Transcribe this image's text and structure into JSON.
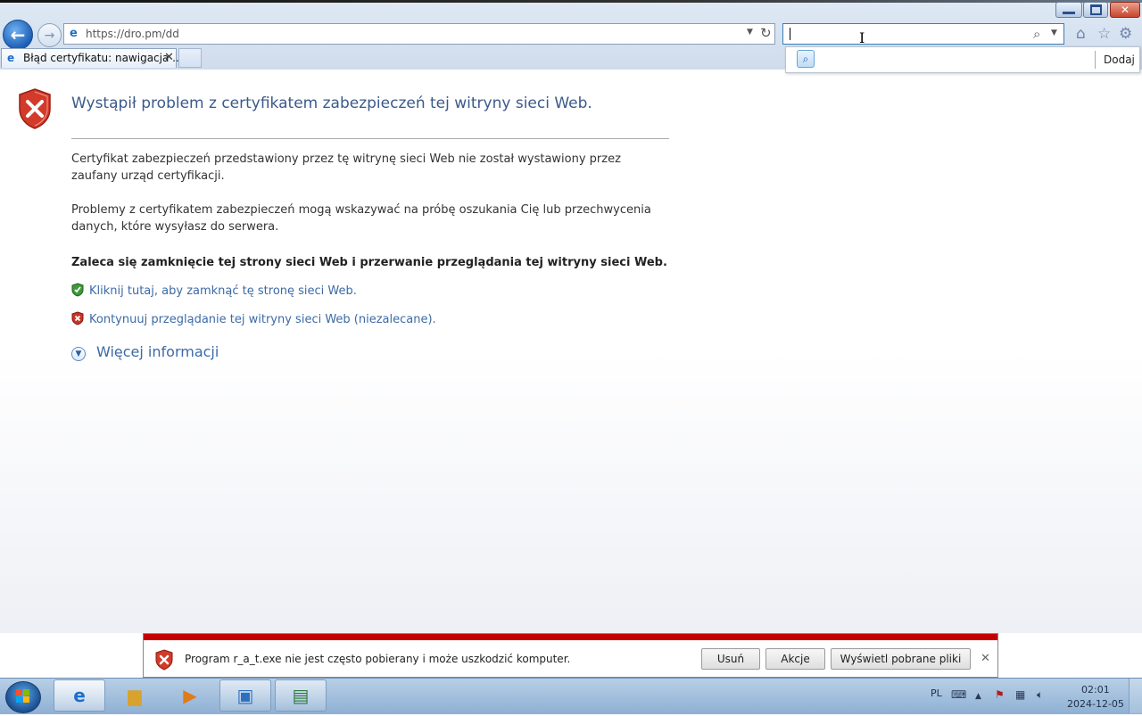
{
  "browser": {
    "url": "https://dro.pm/dd",
    "tab_title": "Błąd certyfikatu: nawigacja ...",
    "search_value": "",
    "suggest_add_label": "Dodaj"
  },
  "page": {
    "title": "Wystąpił problem z certyfikatem zabezpieczeń tej witryny sieci Web.",
    "paragraph1": "Certyfikat zabezpieczeń przedstawiony przez tę witrynę sieci Web nie został wystawiony przez zaufany urząd certyfikacji.",
    "paragraph2": "Problemy z certyfikatem zabezpieczeń mogą wskazywać na próbę oszukania Cię lub przechwycenia danych, które wysyłasz do serwera.",
    "recommendation": "Zaleca się zamknięcie tej strony sieci Web i przerwanie przeglądania tej witryny sieci Web.",
    "close_link": "Kliknij tutaj, aby zamknąć tę stronę sieci Web.",
    "continue_link": "Kontynuuj przeglądanie tej witryny sieci Web (niezalecane).",
    "more_info": "Więcej informacji"
  },
  "download_bar": {
    "message": "Program r_a_t.exe nie jest często pobierany i może uszkodzić komputer.",
    "remove_label": "Usuń",
    "actions_label": "Akcje",
    "view_label": "Wyświetl pobrane pliki"
  },
  "taskbar": {
    "language": "PL",
    "time": "02:01",
    "date": "2024-12-05"
  },
  "colors": {
    "warning_red": "#c40000",
    "link_blue": "#3c6aa6",
    "title_blue": "#3b5a8a"
  }
}
